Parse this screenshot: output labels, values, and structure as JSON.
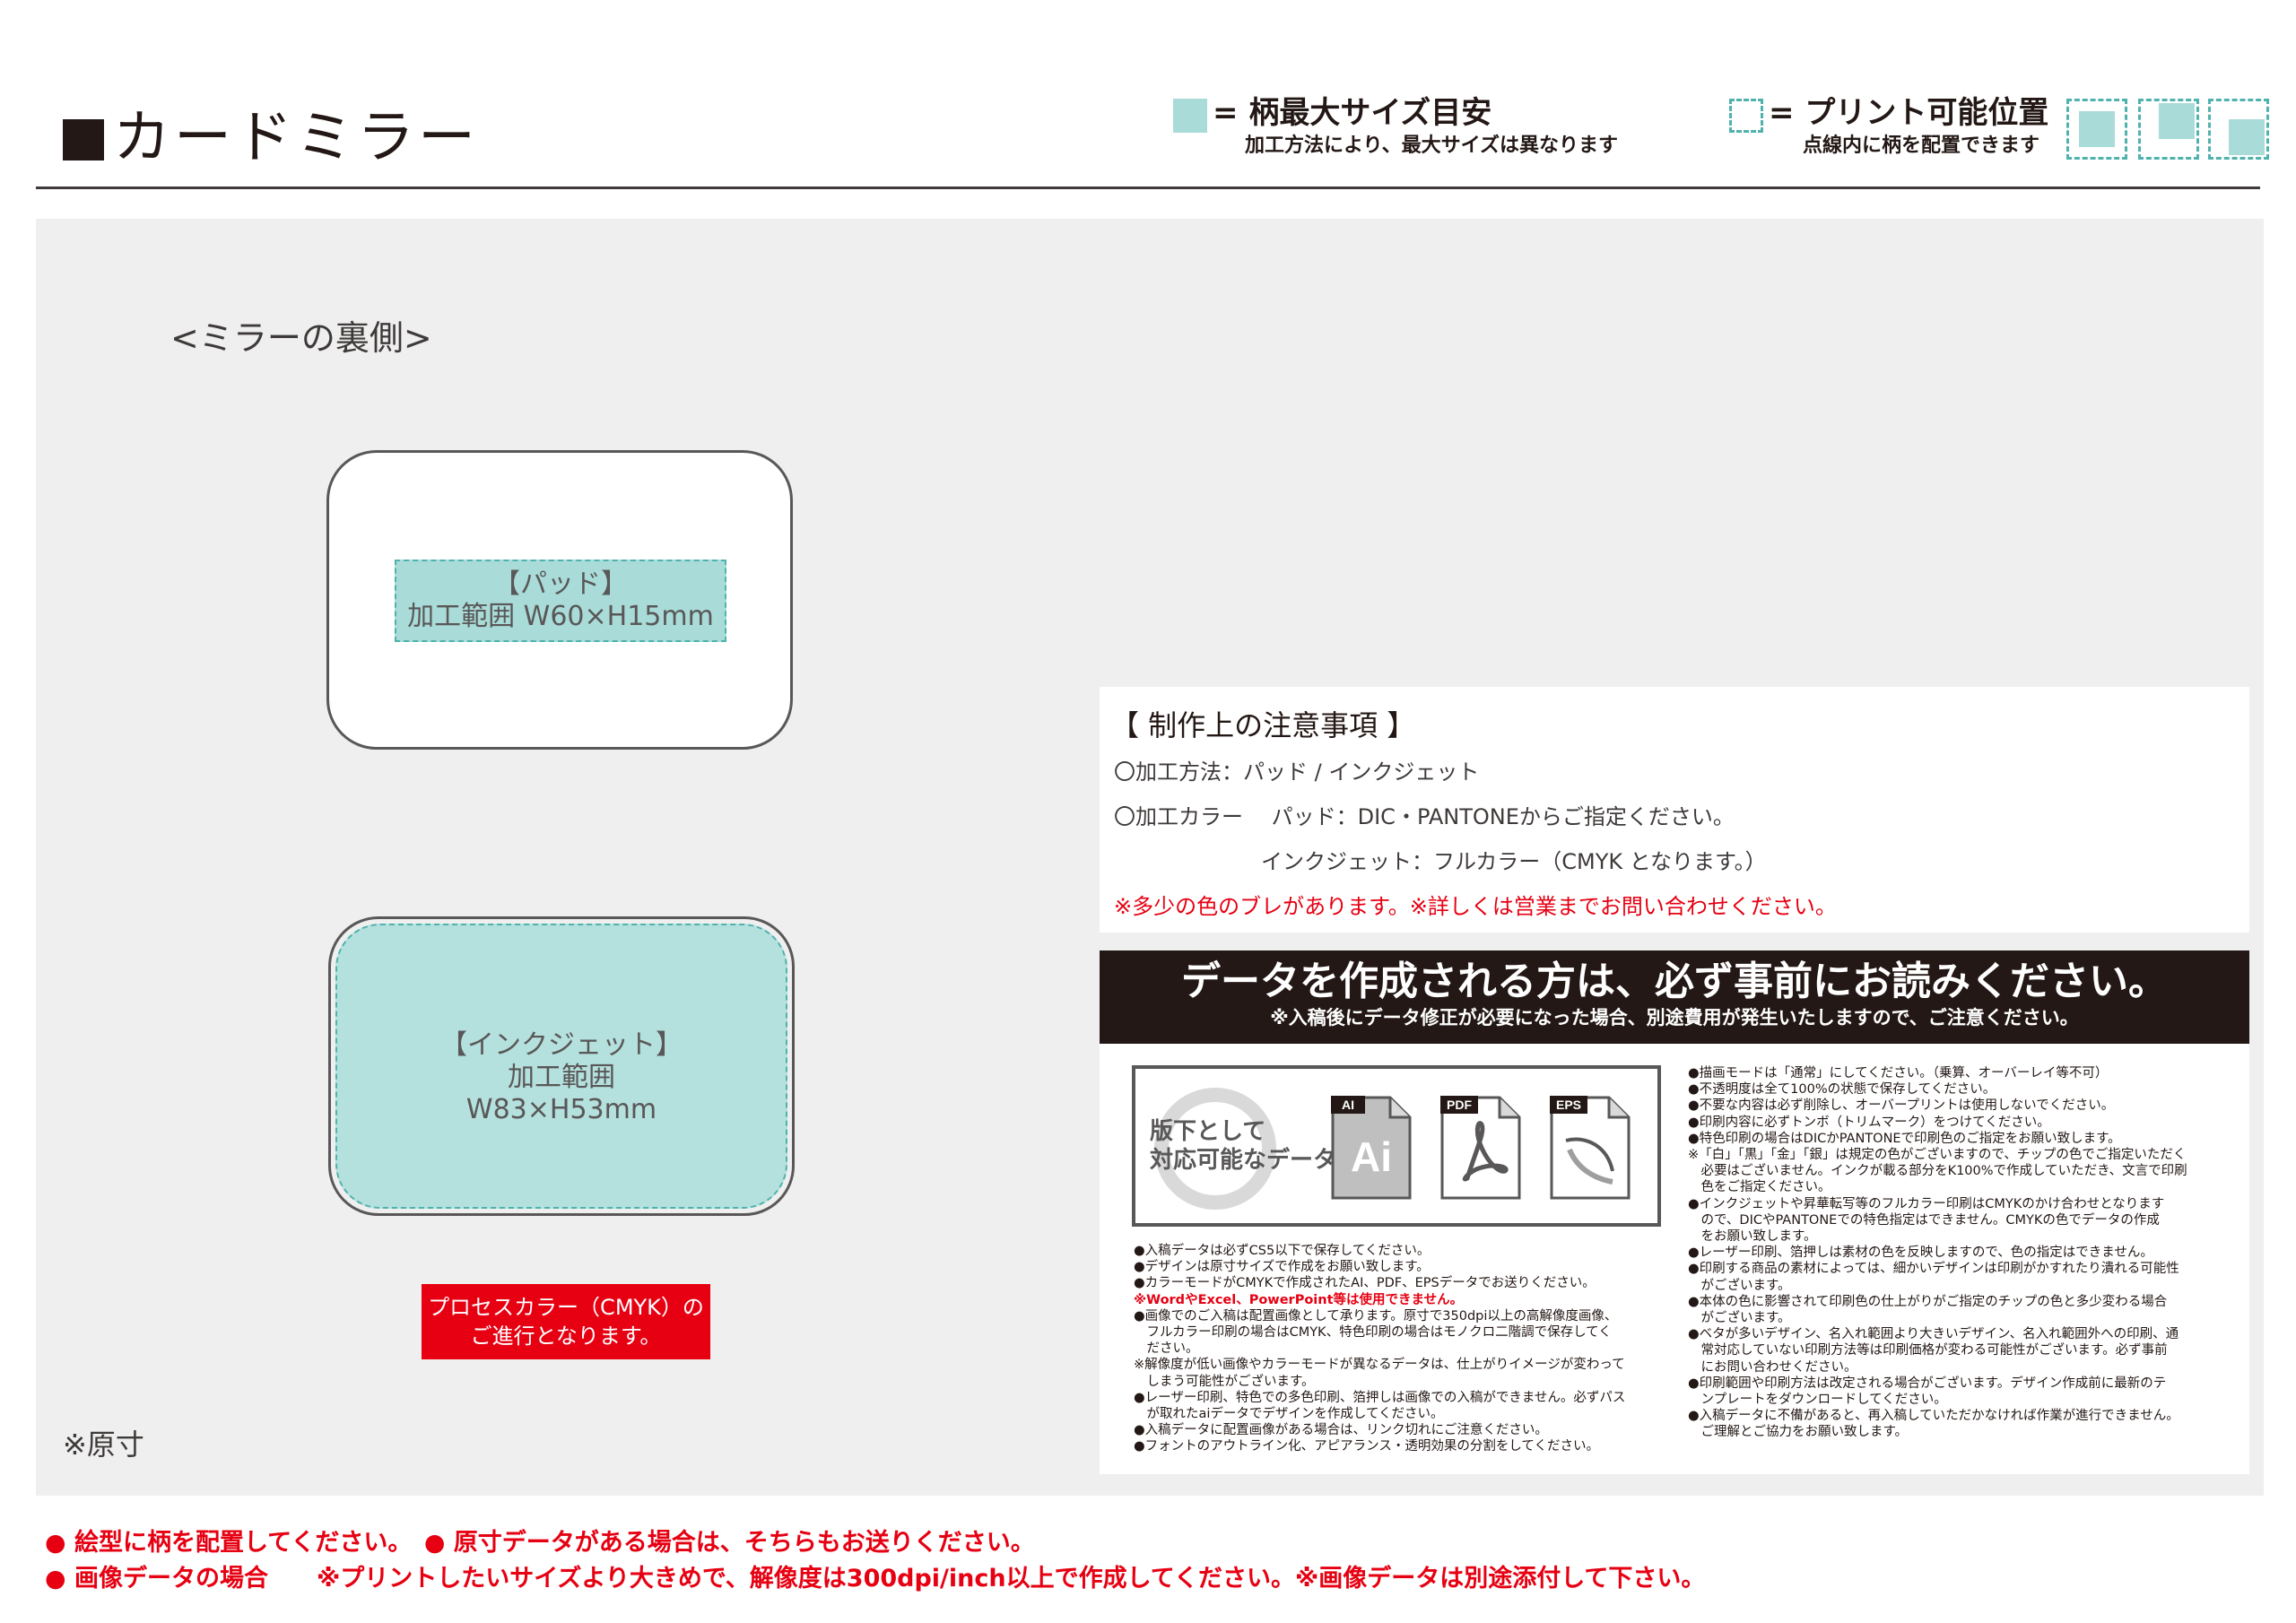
{
  "header": {
    "title": "カードミラー",
    "legend_fill_label": "= 柄最大サイズ目安",
    "legend_fill_sub": "加工方法により、最大サイズは異なります",
    "legend_dash_label": "= プリント可能位置",
    "legend_dash_sub": "点線内に柄を配置できます"
  },
  "colors": {
    "accent_fill": "#a9dcd9",
    "dash_stroke": "#4fb2ad",
    "alert_red": "#e60012",
    "ink": "#231815"
  },
  "diagram": {
    "section_label": "<ミラーの裏側>",
    "pad_title": "【パッド】",
    "pad_range": "加工範囲 W60×H15mm",
    "inkjet_title": "【インクジェット】",
    "inkjet_range_label": "加工範囲",
    "inkjet_range_size": "W83×H53mm",
    "process_line1": "プロセスカラー（CMYK）の",
    "process_line2": "ご進行となります。",
    "actual_size": "※原寸"
  },
  "notes": {
    "title": "【 制作上の注意事項 】",
    "method": "〇加工方法：パッド / インクジェット",
    "color_pad": "〇加工カラー　 パッド：DIC・PANTONEからご指定ください。",
    "color_inkjet": "インクジェット：フルカラー（CMYK となります。）",
    "warning": "※多少の色のブレがあります。※詳しくは営業までお問い合わせください。"
  },
  "data_box": {
    "header_main": "データを作成される方は、必ず事前にお読みください。",
    "header_sub": "※入稿後にデータ修正が必要になった場合、別途費用が発生いたしますので、ご注意ください。",
    "formats_label_1": "版下として",
    "formats_label_2": "対応可能なデータ",
    "formats": [
      "AI",
      "PDF",
      "EPS"
    ],
    "ai_glyph": "Ai",
    "left_items": [
      "●入稿データは必ずCS5以下で保存してください。",
      "●デザインは原寸サイズで作成をお願い致します。",
      "●カラーモードがCMYKで作成されたAI、PDF、EPSデータでお送りください。",
      "※WordやExcel、PowerPoint等は使用できません。",
      "●画像でのご入稿は配置画像として承ります。原寸で350dpi以上の高解像度画像、",
      "　フルカラー印刷の場合はCMYK、特色印刷の場合はモノクロ二階調で保存してく",
      "　ださい。",
      "※解像度が低い画像やカラーモードが異なるデータは、仕上がりイメージが変わって",
      "　しまう可能性がございます。",
      "●レーザー印刷、特色での多色印刷、箔押しは画像での入稿ができません。必ずパス",
      "　が取れたaiデータでデザインを作成してください。",
      "●入稿データに配置画像がある場合は、リンク切れにご注意ください。",
      "●フォントのアウトライン化、アピアランス・透明効果の分割をしてください。"
    ],
    "right_items": [
      "●描画モードは「通常」にしてください。（乗算、オーバーレイ等不可）",
      "●不透明度は全て100%の状態で保存してください。",
      "●不要な内容は必ず削除し、オーバープリントは使用しないでください。",
      "●印刷内容に必ずトンボ（トリムマーク）をつけてください。",
      "●特色印刷の場合はDICかPANTONEで印刷色のご指定をお願い致します。",
      "※「白」「黒」「金」「銀」は規定の色がございますので、チップの色でご指定いただく",
      "　必要はございません。インクが載る部分をK100%で作成していただき、文言で印刷",
      "　色をご指定ください。",
      "●インクジェットや昇華転写等のフルカラー印刷はCMYKのかけ合わせとなります",
      "　ので、DICやPANTONEでの特色指定はできません。CMYKの色でデータの作成",
      "　をお願い致します。",
      "●レーザー印刷、箔押しは素材の色を反映しますので、色の指定はできません。",
      "●印刷する商品の素材によっては、細かいデザインは印刷がかすれたり潰れる可能性",
      "　がございます。",
      "●本体の色に影響されて印刷色の仕上がりがご指定のチップの色と多少変わる場合",
      "　がございます。",
      "●ベタが多いデザイン、名入れ範囲より大きいデザイン、名入れ範囲外への印刷、通",
      "　常対応していない印刷方法等は印刷価格が変わる可能性がございます。必ず事前",
      "　にお問い合わせください。",
      "●印刷範囲や印刷方法は改定される場合がございます。デザイン作成前に最新のテ",
      "　ンプレートをダウンロードしてください。",
      "●入稿データに不備があると、再入稿していただかなければ作業が進行できません。",
      "　ご理解とご協力をお願い致します。"
    ]
  },
  "footer": {
    "line1": "● 絵型に柄を配置してください。　● 原寸データがある場合は、そちらもお送りください。",
    "line2": "● 画像データの場合　　※プリントしたいサイズより大きめで、解像度は300dpi/inch以上で作成してください。※画像データは別途添付して下さい。"
  }
}
